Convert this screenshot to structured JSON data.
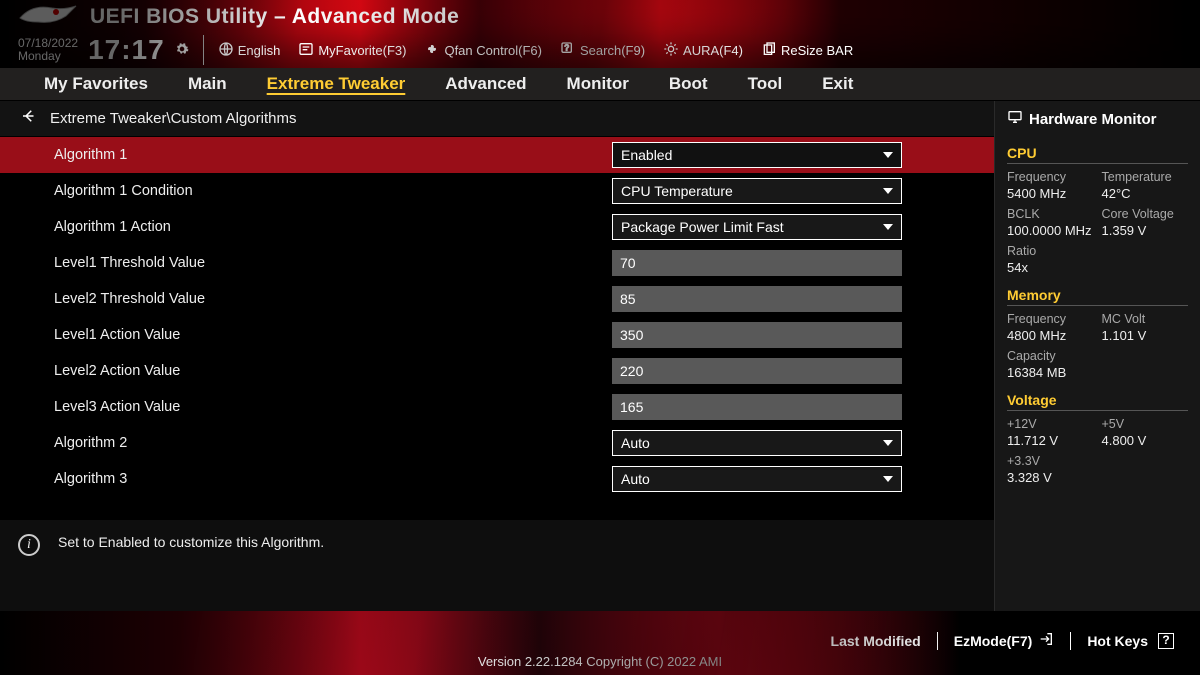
{
  "header": {
    "title": "UEFI BIOS Utility – Advanced Mode"
  },
  "datetime": {
    "date": "07/18/2022",
    "day": "Monday",
    "time": "17:17"
  },
  "toolbar": {
    "language_label": "English",
    "myfavorite_label": "MyFavorite(F3)",
    "qfan_label": "Qfan Control(F6)",
    "search_label": "Search(F9)",
    "aura_label": "AURA(F4)",
    "resize_bar_label": "ReSize BAR"
  },
  "tabs": {
    "items": [
      "My Favorites",
      "Main",
      "Extreme Tweaker",
      "Advanced",
      "Monitor",
      "Boot",
      "Tool",
      "Exit"
    ],
    "active_index": 2
  },
  "breadcrumb": "Extreme Tweaker\\Custom Algorithms",
  "settings": [
    {
      "label": "Algorithm 1",
      "type": "dropdown",
      "value": "Enabled",
      "selected": true
    },
    {
      "label": "Algorithm 1 Condition",
      "type": "dropdown",
      "value": "CPU Temperature"
    },
    {
      "label": "Algorithm 1 Action",
      "type": "dropdown",
      "value": "Package Power Limit Fast"
    },
    {
      "label": "Level1 Threshold Value",
      "type": "text",
      "value": "70"
    },
    {
      "label": "Level2 Threshold Value",
      "type": "text",
      "value": "85"
    },
    {
      "label": "Level1 Action Value",
      "type": "text",
      "value": "350"
    },
    {
      "label": "Level2 Action Value",
      "type": "text",
      "value": "220"
    },
    {
      "label": "Level3 Action Value",
      "type": "text",
      "value": "165"
    },
    {
      "label": "Algorithm 2",
      "type": "dropdown",
      "value": "Auto"
    },
    {
      "label": "Algorithm 3",
      "type": "dropdown",
      "value": "Auto"
    }
  ],
  "help_text": "Set to Enabled to customize this Algorithm.",
  "sidebar": {
    "title": "Hardware Monitor",
    "sections": [
      {
        "title": "CPU",
        "rows": [
          {
            "labels": [
              "Frequency",
              "Temperature"
            ],
            "values": [
              "5400 MHz",
              "42°C"
            ]
          },
          {
            "labels": [
              "BCLK",
              "Core Voltage"
            ],
            "values": [
              "100.0000 MHz",
              "1.359 V"
            ]
          },
          {
            "labels": [
              "Ratio",
              ""
            ],
            "values": [
              "54x",
              ""
            ]
          }
        ]
      },
      {
        "title": "Memory",
        "rows": [
          {
            "labels": [
              "Frequency",
              "MC Volt"
            ],
            "values": [
              "4800 MHz",
              "1.101 V"
            ]
          },
          {
            "labels": [
              "Capacity",
              ""
            ],
            "values": [
              "16384 MB",
              ""
            ]
          }
        ]
      },
      {
        "title": "Voltage",
        "rows": [
          {
            "labels": [
              "+12V",
              "+5V"
            ],
            "values": [
              "11.712 V",
              "4.800 V"
            ]
          },
          {
            "labels": [
              "+3.3V",
              ""
            ],
            "values": [
              "3.328 V",
              ""
            ]
          }
        ]
      }
    ]
  },
  "footer": {
    "last_modified": "Last Modified",
    "ezmode": "EzMode(F7)",
    "hotkeys": "Hot Keys",
    "hotkeys_icon": "?",
    "copyright": "Version 2.22.1284 Copyright (C) 2022 AMI"
  }
}
